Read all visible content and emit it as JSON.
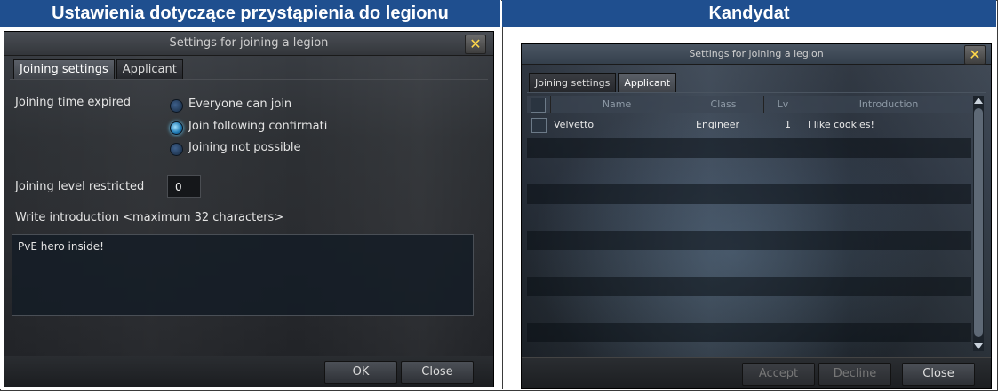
{
  "headers": {
    "left": "Ustawienia dotyczące przystąpienia do legionu",
    "right": "Kandydat"
  },
  "left_window": {
    "title": "Settings for joining a legion",
    "close_glyph": "✕",
    "tabs": [
      {
        "label": "Joining settings",
        "active": true
      },
      {
        "label": "Applicant",
        "active": false
      }
    ],
    "joining_time_label": "Joining time expired",
    "radio_options": [
      {
        "label": "Everyone can join",
        "selected": false
      },
      {
        "label": "Join following confirmati",
        "selected": true
      },
      {
        "label": "Joining not possible",
        "selected": false
      }
    ],
    "level_label": "Joining level restricted",
    "level_value": "0",
    "intro_label": "Write introduction <maximum 32 characters>",
    "intro_value": "PvE hero inside!",
    "buttons": {
      "ok": "OK",
      "close": "Close"
    }
  },
  "right_window": {
    "title": "Settings for joining a legion",
    "close_glyph": "✕",
    "tabs": [
      {
        "label": "Joining settings",
        "active": false
      },
      {
        "label": "Applicant",
        "active": true
      }
    ],
    "columns": [
      "Name",
      "Class",
      "Lv",
      "Introduction"
    ],
    "rows": [
      {
        "name": "Velvetto",
        "class": "Engineer",
        "lv": "1",
        "intro": "I like cookies!"
      }
    ],
    "buttons": {
      "accept": "Accept",
      "decline": "Decline",
      "close": "Close"
    }
  },
  "colors": {
    "header_bg": "#1f4f8f",
    "close_x": "#ffd84a",
    "selected_radio": "#1d77b0"
  }
}
